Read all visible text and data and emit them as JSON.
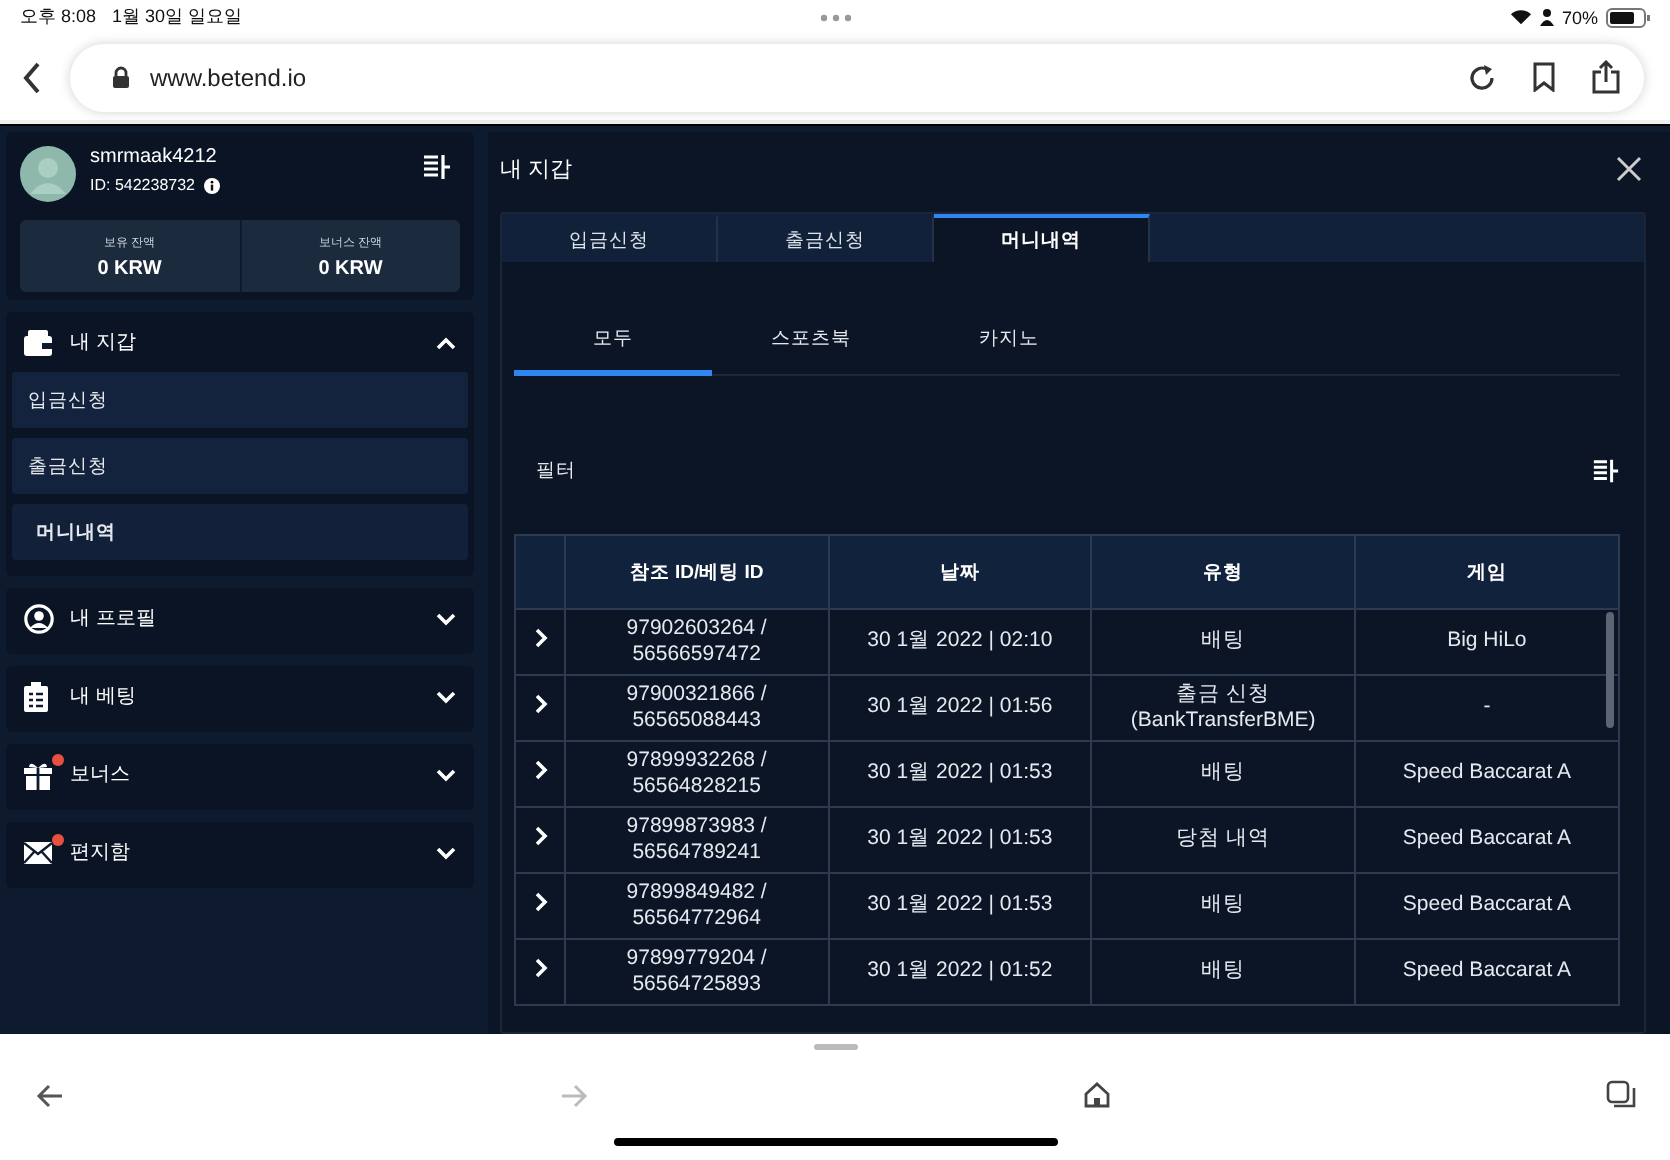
{
  "status_bar": {
    "time": "오후 8:08",
    "date": "1월 30일 일요일",
    "battery": "70%"
  },
  "browser": {
    "url": "www.betend.io"
  },
  "sidebar": {
    "username": "smrmaak4212",
    "user_id": "ID: 542238732",
    "balances": [
      {
        "label": "보유 잔액",
        "value": "0 KRW"
      },
      {
        "label": "보너스 잔액",
        "value": "0 KRW"
      }
    ],
    "sections": [
      {
        "label": "내 지갑",
        "expanded": true,
        "badge": false,
        "children": [
          {
            "label": "입금신청",
            "selected": false
          },
          {
            "label": "출금신청",
            "selected": false
          },
          {
            "label": "머니내역",
            "selected": true
          }
        ]
      },
      {
        "label": "내 프로필",
        "expanded": false,
        "badge": false
      },
      {
        "label": "내 베팅",
        "expanded": false,
        "badge": false
      },
      {
        "label": "보너스",
        "expanded": false,
        "badge": true
      },
      {
        "label": "편지함",
        "expanded": false,
        "badge": true
      }
    ]
  },
  "panel": {
    "title": "내 지갑",
    "tabs": [
      {
        "label": "입금신청",
        "selected": false
      },
      {
        "label": "출금신청",
        "selected": false
      },
      {
        "label": "머니내역",
        "selected": true
      }
    ],
    "subtabs": [
      {
        "label": "모두",
        "selected": true
      },
      {
        "label": "스포츠북",
        "selected": false
      },
      {
        "label": "카지노",
        "selected": false
      }
    ],
    "filter_label": "필터",
    "table": {
      "columns": [
        "참조 ID/베팅 ID",
        "날짜",
        "유형",
        "게임"
      ],
      "rows": [
        {
          "id": "97902603264 / 56566597472",
          "date": "30 1월 2022 | 02:10",
          "type": "배팅",
          "game": "Big HiLo"
        },
        {
          "id": "97900321866 / 56565088443",
          "date": "30 1월 2022 | 01:56",
          "type": "출금 신청 (BankTransferBME)",
          "game": "-"
        },
        {
          "id": "97899932268 / 56564828215",
          "date": "30 1월 2022 | 01:53",
          "type": "배팅",
          "game": "Speed Baccarat A"
        },
        {
          "id": "97899873983 / 56564789241",
          "date": "30 1월 2022 | 01:53",
          "type": "당첨 내역",
          "game": "Speed Baccarat A"
        },
        {
          "id": "97899849482 / 56564772964",
          "date": "30 1월 2022 | 01:53",
          "type": "배팅",
          "game": "Speed Baccarat A"
        },
        {
          "id": "97899779204 / 56564725893",
          "date": "30 1월 2022 | 01:52",
          "type": "배팅",
          "game": "Speed Baccarat A"
        }
      ]
    }
  }
}
